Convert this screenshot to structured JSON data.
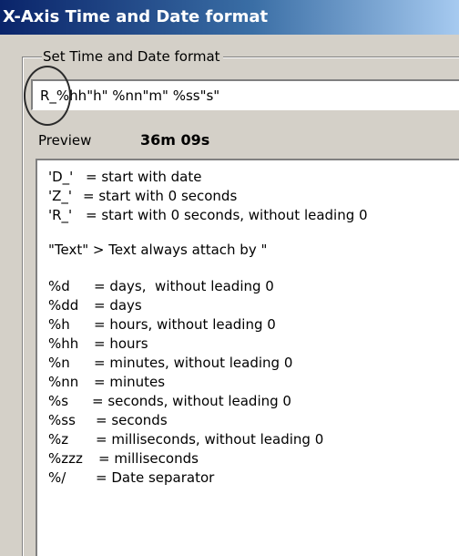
{
  "window": {
    "title": "X-Axis Time and Date format"
  },
  "format_group": {
    "legend": "Set Time and Date format",
    "input_value": "R_%hh\"h\" %nn\"m\" %ss\"s\""
  },
  "preview": {
    "label": "Preview",
    "value": "36m 09s"
  },
  "help": {
    "lines": [
      {
        "code": "'D_'",
        "desc": "= start with date"
      },
      {
        "code": "'Z_'",
        "desc": "= start with 0 seconds"
      },
      {
        "code": "'R_'",
        "desc": "= start with 0 seconds, without leading 0"
      },
      {
        "code": "\"Text\" > Text always attach by \"",
        "desc": ""
      },
      {
        "code": "%d",
        "desc": "= days,  without leading 0"
      },
      {
        "code": "%dd",
        "desc": "= days"
      },
      {
        "code": "%h",
        "desc": "= hours, without leading 0"
      },
      {
        "code": "%hh",
        "desc": "= hours"
      },
      {
        "code": "%n",
        "desc": "= minutes, without leading 0"
      },
      {
        "code": "%nn",
        "desc": "= minutes"
      },
      {
        "code": "%s",
        "desc": "= seconds, without leading 0"
      },
      {
        "code": "%ss",
        "desc": "= seconds"
      },
      {
        "code": "%z",
        "desc": "= milliseconds, without leading 0"
      },
      {
        "code": "%zzz",
        "desc": "= milliseconds"
      },
      {
        "code": "%/",
        "desc": "= Date separator"
      }
    ]
  }
}
